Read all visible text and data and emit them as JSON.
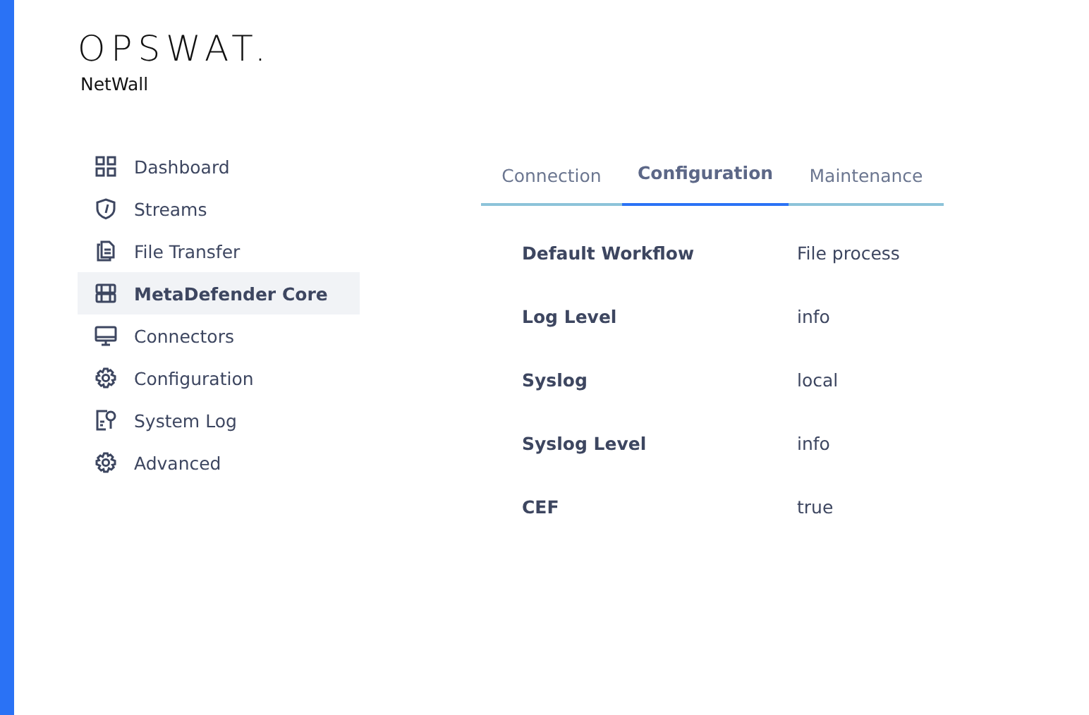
{
  "brand": {
    "logo": "OPSWAT.",
    "product": "NetWall"
  },
  "sidebar": {
    "items": [
      {
        "label": "Dashboard",
        "selected": false
      },
      {
        "label": "Streams",
        "selected": false
      },
      {
        "label": "File Transfer",
        "selected": false
      },
      {
        "label": "MetaDefender Core",
        "selected": true
      },
      {
        "label": "Connectors",
        "selected": false
      },
      {
        "label": "Configuration",
        "selected": false
      },
      {
        "label": "System Log",
        "selected": false
      },
      {
        "label": "Advanced",
        "selected": false
      }
    ]
  },
  "tabs": [
    {
      "label": "Connection",
      "selected": false
    },
    {
      "label": "Configuration",
      "selected": true
    },
    {
      "label": "Maintenance",
      "selected": false
    }
  ],
  "settings": [
    {
      "label": "Default Workflow",
      "value": "File process"
    },
    {
      "label": "Log Level",
      "value": "info"
    },
    {
      "label": "Syslog",
      "value": "local"
    },
    {
      "label": "Syslog Level",
      "value": "info"
    },
    {
      "label": "CEF",
      "value": "true"
    }
  ]
}
